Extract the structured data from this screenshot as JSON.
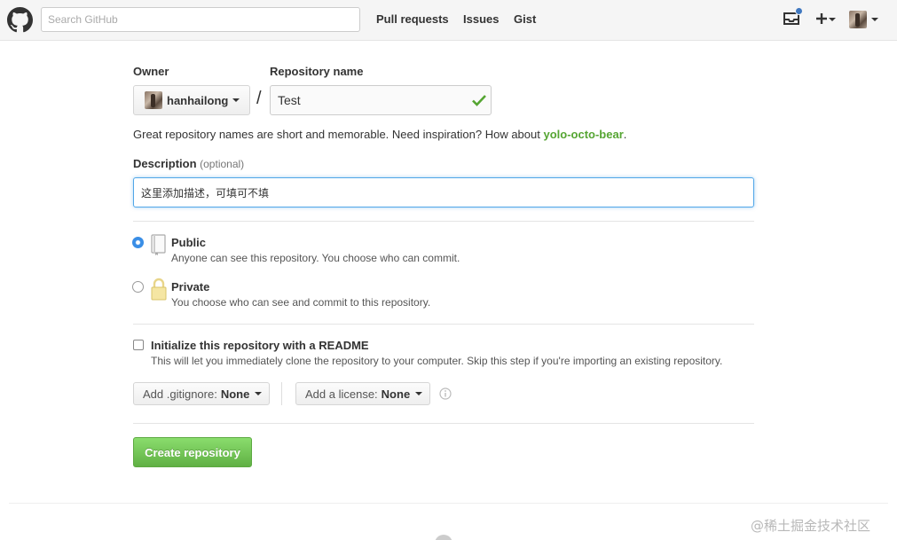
{
  "header": {
    "search_placeholder": "Search GitHub",
    "nav": [
      "Pull requests",
      "Issues",
      "Gist"
    ],
    "icons": {
      "logo": "github-octocat-icon",
      "notifications": "inbox-icon",
      "create": "plus-icon",
      "user": "avatar"
    },
    "notification_dot_color": "#4078c0"
  },
  "form": {
    "owner_label": "Owner",
    "owner_value": "hanhailong",
    "separator": "/",
    "repo_label": "Repository name",
    "repo_value": "Test",
    "repo_valid": true,
    "hint_prefix": "Great repository names are short and memorable. Need inspiration? How about ",
    "hint_suggestion": "yolo-octo-bear",
    "hint_suffix": ".",
    "description_label": "Description",
    "description_optional": "(optional)",
    "description_value": "这里添加描述，可填可不填",
    "visibility": {
      "selected": "public",
      "public_title": "Public",
      "public_desc": "Anyone can see this repository. You choose who can commit.",
      "private_title": "Private",
      "private_desc": "You choose who can see and commit to this repository."
    },
    "readme": {
      "checked": false,
      "title": "Initialize this repository with a README",
      "desc": "This will let you immediately clone the repository to your computer. Skip this step if you're importing an existing repository."
    },
    "gitignore_label": "Add .gitignore:",
    "gitignore_value": "None",
    "license_label": "Add a license:",
    "license_value": "None",
    "create_label": "Create repository"
  },
  "colors": {
    "accent_blue": "#51a7e8",
    "success_green": "#55a532",
    "create_button": "#60b044"
  },
  "watermark": "@稀土掘金技术社区"
}
